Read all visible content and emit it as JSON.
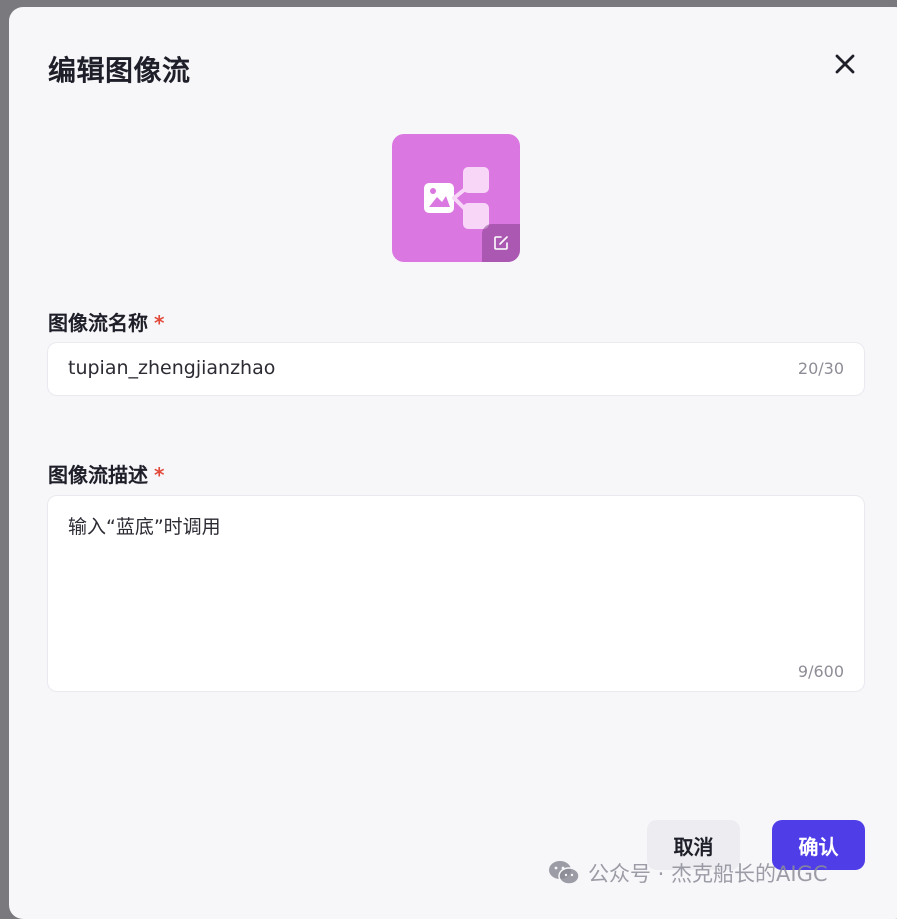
{
  "dialog": {
    "title": "编辑图像流",
    "close_icon": "close-icon",
    "tile_color": "#db77e0",
    "tile_icon": "image-flow-icon",
    "edit_icon": "edit-icon"
  },
  "name_field": {
    "label": "图像流名称",
    "required_mark": "*",
    "value": "tupian_zhengjianzhao",
    "counter": "20/30"
  },
  "desc_field": {
    "label": "图像流描述",
    "required_mark": "*",
    "value": "输入“蓝底”时调用",
    "counter": "9/600"
  },
  "buttons": {
    "cancel": "取消",
    "confirm": "确认"
  },
  "colors": {
    "accent": "#4f3ee8",
    "required": "#e24b3b"
  },
  "watermark": {
    "icon": "wechat-icon",
    "text": "公众号 · 杰克船长的AIGC"
  }
}
